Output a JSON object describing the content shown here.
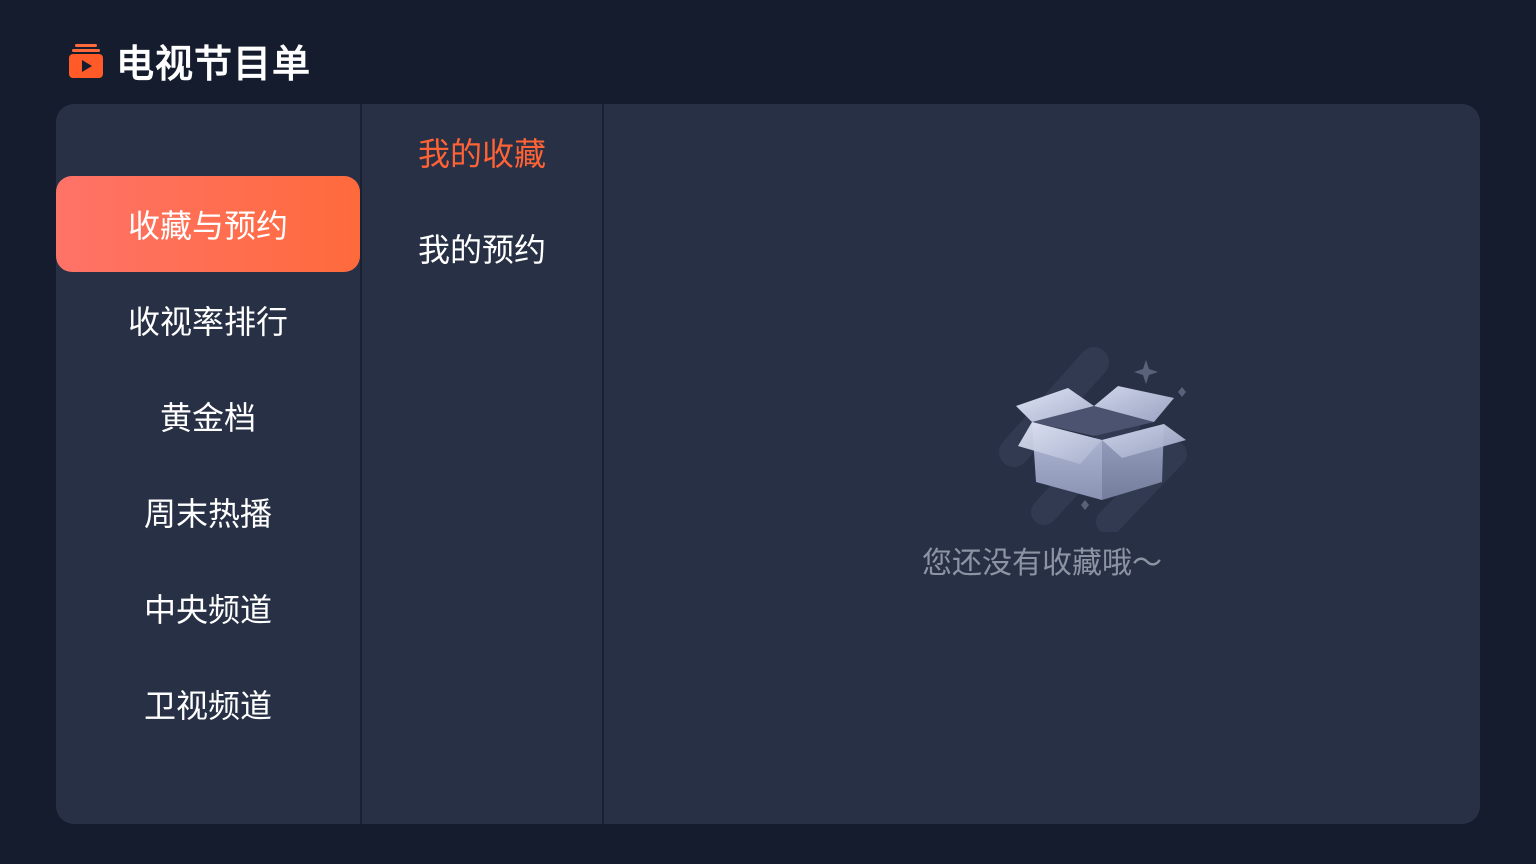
{
  "header": {
    "title": "电视节目单",
    "logo_icon": "tv-play-icon"
  },
  "colors": {
    "background": "#141c2e",
    "panel": "#283045",
    "accent": "#ff6235",
    "active_gradient_start": "#ff7368",
    "active_gradient_end": "#ff6a3c"
  },
  "sidebar": {
    "items": [
      {
        "label": "收藏与预约",
        "active": true
      },
      {
        "label": "收视率排行",
        "active": false
      },
      {
        "label": "黄金档",
        "active": false
      },
      {
        "label": "周末热播",
        "active": false
      },
      {
        "label": "中央频道",
        "active": false
      },
      {
        "label": "卫视频道",
        "active": false
      }
    ]
  },
  "subnav": {
    "items": [
      {
        "label": "我的收藏",
        "active": true
      },
      {
        "label": "我的预约",
        "active": false
      }
    ]
  },
  "content": {
    "empty_icon": "empty-box-icon",
    "empty_text": "您还没有收藏哦～"
  }
}
